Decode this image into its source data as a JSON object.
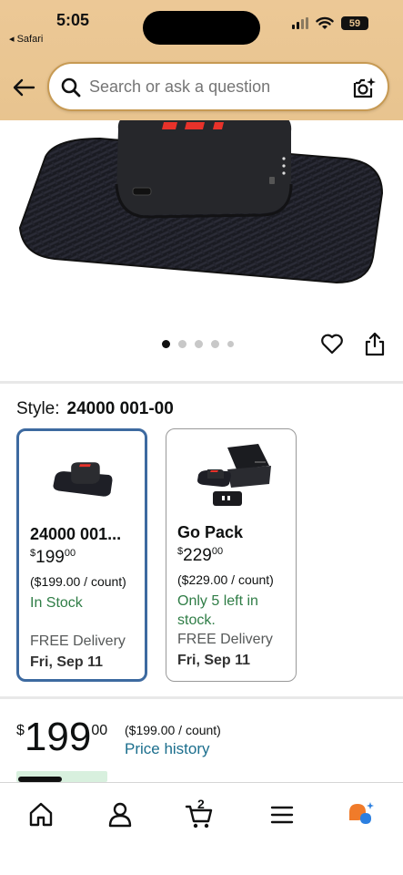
{
  "status_bar": {
    "time": "5:05",
    "back_app": "◂ Safari",
    "battery": "59"
  },
  "search": {
    "placeholder": "Search or ask a question"
  },
  "product": {
    "image_dots": 5,
    "active_dot": 0
  },
  "style": {
    "label": "Style:",
    "value": "24000 001-00"
  },
  "options": [
    {
      "title": "24000 001...",
      "price_currency": "$",
      "price_whole": "199",
      "price_fraction": "00",
      "unit_price": "($199.00 / count)",
      "stock": "In Stock",
      "delivery": "FREE Delivery",
      "date": "Fri, Sep 11",
      "selected": true
    },
    {
      "title": "Go Pack",
      "price_currency": "$",
      "price_whole": "229",
      "price_fraction": "00",
      "unit_price": "($229.00 / count)",
      "stock": "Only 5 left in stock.",
      "delivery": "FREE Delivery",
      "date": "Fri, Sep 11",
      "selected": false
    }
  ],
  "price": {
    "currency": "$",
    "whole": "199",
    "fraction": "00",
    "unit": "($199.00 / count)",
    "history_link": "Price history"
  },
  "bottom_nav": {
    "items": [
      "home-icon",
      "account-icon",
      "cart-icon",
      "menu-icon",
      "rufus-icon"
    ],
    "cart_count": "2"
  },
  "colors": {
    "header_bg": "#e9c48f",
    "selected_border": "#3d6aa0",
    "in_stock": "#2f7d46",
    "link": "#1b6e8d"
  }
}
